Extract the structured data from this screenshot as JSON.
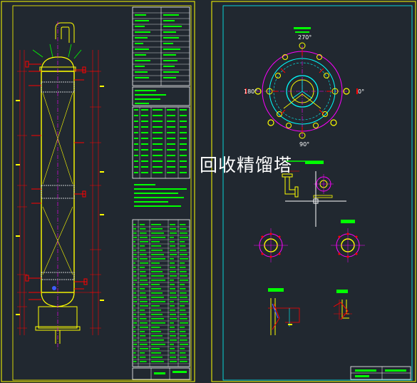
{
  "drawing_title": "回收精馏塔",
  "angles": {
    "top": "270°",
    "left": "180°",
    "right": "0°",
    "bottom": "90°"
  },
  "colors": {
    "background": "#212830",
    "frame": "#ffff00",
    "sheet2_frame": "#00ffff",
    "table_lines": "#ffffff",
    "table_text": "#00ff00",
    "column": "#ffff00",
    "nozzles": "#ff0000",
    "center_lines": "#ff00ff",
    "dimension": "#ff0000",
    "inner_ring": "#00ffff",
    "tags": "#00ff00"
  }
}
